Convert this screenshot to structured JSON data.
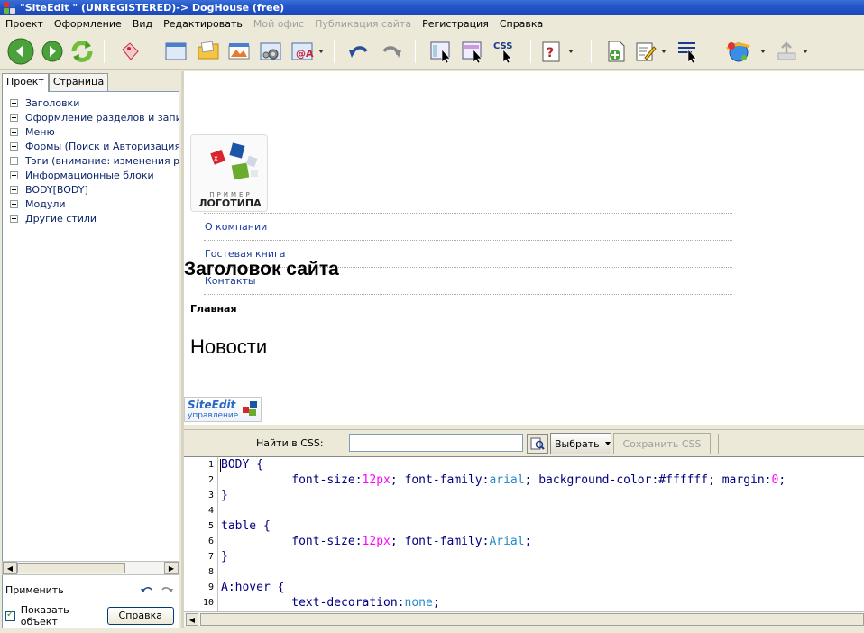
{
  "window": {
    "title": "\"SiteEdit \" (UNREGISTERED)-> DogHouse (free)"
  },
  "menu": {
    "items": [
      {
        "label": "Проект",
        "disabled": false
      },
      {
        "label": "Оформление",
        "disabled": false
      },
      {
        "label": "Вид",
        "disabled": false
      },
      {
        "label": "Редактировать",
        "disabled": false
      },
      {
        "label": "Мой офис",
        "disabled": true
      },
      {
        "label": "Публикация сайта",
        "disabled": true
      },
      {
        "label": "Регистрация",
        "disabled": false
      },
      {
        "label": "Справка",
        "disabled": false
      }
    ]
  },
  "toolbar": {
    "css_label": "CSS"
  },
  "left_panel": {
    "tabs": [
      "Проект",
      "Страница"
    ],
    "active_tab": 0,
    "tree": [
      "Заголовки",
      "Оформление разделов и записей",
      "Меню",
      "Формы (Поиск и Авторизация)",
      "Тэги (внимание: изменения распространяются на все элементы)",
      "Информационные блоки",
      "BODY[BODY]",
      "Модули",
      "Другие стили"
    ],
    "apply_label": "Применить",
    "show_object_label": "Показать объект",
    "show_object_checked": true,
    "help_button": "Справка"
  },
  "preview": {
    "logo_line1": "ПРИМЕР",
    "logo_line2": "ЛОГОТИПА",
    "nav_links": [
      "О компании",
      "Гостевая книга",
      "Контакты"
    ],
    "site_title": "Заголовок сайта",
    "main_label": "Главная",
    "news_heading": "Новости",
    "badge_line1": "SiteEdit",
    "badge_line2": "управление"
  },
  "css_panel": {
    "find_label": "Найти в CSS:",
    "search_value": "",
    "select_button": "Выбрать",
    "save_button": "Сохранить CSS"
  },
  "editor": {
    "line_numbers": [
      "1",
      "2",
      "3",
      "4",
      "5",
      "6",
      "7",
      "8",
      "9",
      "10"
    ],
    "lines": [
      [
        {
          "t": "BODY {",
          "c": "kw"
        }
      ],
      [
        {
          "t": "          font-size:",
          "c": "kw"
        },
        {
          "t": "12px",
          "c": "num"
        },
        {
          "t": "; font-family:",
          "c": "kw"
        },
        {
          "t": "arial",
          "c": "val"
        },
        {
          "t": "; background-color:#ffffff; margin:",
          "c": "kw"
        },
        {
          "t": "0",
          "c": "num"
        },
        {
          "t": ";",
          "c": "kw"
        }
      ],
      [
        {
          "t": "}",
          "c": "kw"
        }
      ],
      [],
      [
        {
          "t": "table {",
          "c": "kw"
        }
      ],
      [
        {
          "t": "          font-size:",
          "c": "kw"
        },
        {
          "t": "12px",
          "c": "num"
        },
        {
          "t": "; font-family:",
          "c": "kw"
        },
        {
          "t": "Arial",
          "c": "val"
        },
        {
          "t": ";",
          "c": "kw"
        }
      ],
      [
        {
          "t": "}",
          "c": "kw"
        }
      ],
      [],
      [
        {
          "t": "A:hover {",
          "c": "kw"
        }
      ],
      [
        {
          "t": "          text-decoration:",
          "c": "kw"
        },
        {
          "t": "none",
          "c": "val"
        },
        {
          "t": ";",
          "c": "kw"
        }
      ]
    ]
  }
}
